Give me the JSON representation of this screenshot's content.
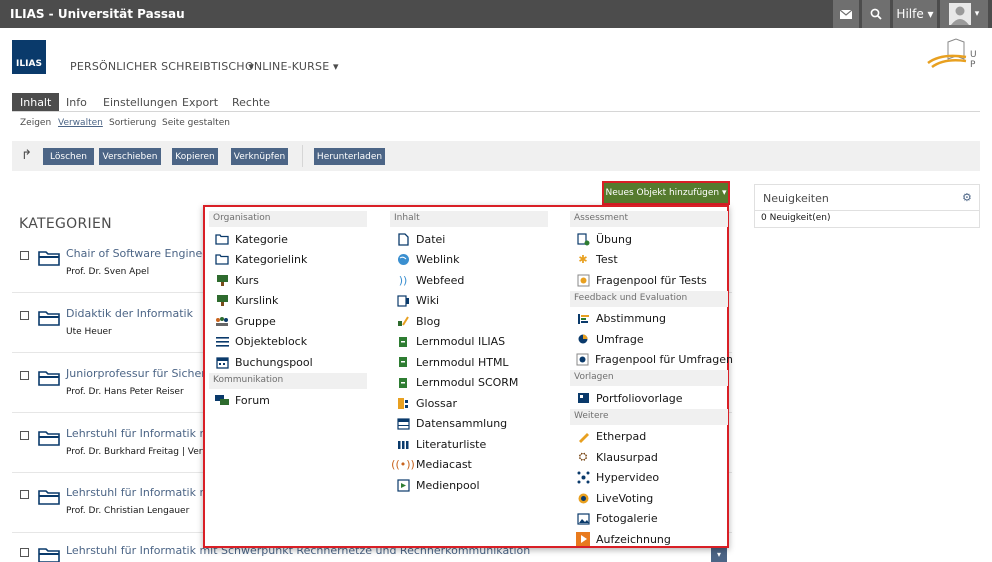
{
  "topbar": {
    "title": "ILIAS - Universität Passau",
    "help_label": "Hilfe ▾",
    "mail_icon": "mail-icon",
    "search_icon": "search-icon",
    "avatar_icon": "avatar-icon"
  },
  "header": {
    "logo_text": "ILIAS",
    "nav": [
      "PERSÖNLICHER SCHREIBTISCH ▾",
      "ONLINE-KURSE ▾"
    ],
    "university_logo": "university-passau-logo"
  },
  "tabs": [
    "Inhalt",
    "Info",
    "Einstellungen",
    "Export",
    "Rechte"
  ],
  "subtabs": [
    "Zeigen",
    "Verwalten",
    "Sortierung",
    "Seite gestalten"
  ],
  "toolbar": {
    "buttons": [
      "Löschen",
      "Verschieben",
      "Kopieren",
      "Verknüpfen",
      "Herunterladen"
    ]
  },
  "add_button": "Neues Objekt hinzufügen ▾",
  "section_title": "KATEGORIEN",
  "categories": [
    {
      "title": "Chair of Software Engineering",
      "desc": "Prof. Dr. Sven Apel"
    },
    {
      "title": "Didaktik der Informatik",
      "desc": "Ute Heuer"
    },
    {
      "title": "Juniorprofessur für Sicherheit",
      "desc": "Prof. Dr. Hans Peter Reiser"
    },
    {
      "title": "Lehrstuhl für Informatik mit S",
      "desc": "Prof. Dr. Burkhard Freitag | Vert"
    },
    {
      "title": "Lehrstuhl für Informatik mit S",
      "desc": "Prof. Dr. Christian Lengauer"
    },
    {
      "title": "Lehrstuhl für Informatik mit Schwerpunkt Rechnernetze und Rechnerkommunikation",
      "desc": ""
    }
  ],
  "news": {
    "title": "Neuigkeiten",
    "count": "0 Neuigkeit(en)"
  },
  "dropdown": {
    "col1": [
      {
        "group": "Organisation",
        "items": [
          {
            "label": "Kategorie",
            "icon": "folder-icon"
          },
          {
            "label": "Kategorielink",
            "icon": "folder-link-icon"
          },
          {
            "label": "Kurs",
            "icon": "course-icon"
          },
          {
            "label": "Kurslink",
            "icon": "course-link-icon"
          },
          {
            "label": "Gruppe",
            "icon": "group-icon"
          },
          {
            "label": "Objekteblock",
            "icon": "list-icon"
          },
          {
            "label": "Buchungspool",
            "icon": "calendar-icon"
          }
        ]
      },
      {
        "group": "Kommunikation",
        "items": [
          {
            "label": "Forum",
            "icon": "forum-icon"
          }
        ]
      }
    ],
    "col2": [
      {
        "group": "Inhalt",
        "items": [
          {
            "label": "Datei",
            "icon": "file-icon"
          },
          {
            "label": "Weblink",
            "icon": "globe-icon"
          },
          {
            "label": "Webfeed",
            "icon": "rss-icon"
          },
          {
            "label": "Wiki",
            "icon": "wiki-icon"
          },
          {
            "label": "Blog",
            "icon": "blog-icon"
          },
          {
            "label": "Lernmodul ILIAS",
            "icon": "module-icon"
          },
          {
            "label": "Lernmodul HTML",
            "icon": "module-html-icon"
          },
          {
            "label": "Lernmodul SCORM",
            "icon": "module-scorm-icon"
          },
          {
            "label": "Glossar",
            "icon": "glossary-icon"
          },
          {
            "label": "Datensammlung",
            "icon": "table-icon"
          },
          {
            "label": "Literaturliste",
            "icon": "books-icon"
          },
          {
            "label": "Mediacast",
            "icon": "broadcast-icon"
          },
          {
            "label": "Medienpool",
            "icon": "media-icon"
          }
        ]
      }
    ],
    "col3": [
      {
        "group": "Assessment",
        "items": [
          {
            "label": "Übung",
            "icon": "exercise-icon"
          },
          {
            "label": "Test",
            "icon": "puzzle-icon"
          },
          {
            "label": "Fragenpool für Tests",
            "icon": "question-pool-icon"
          }
        ]
      },
      {
        "group": "Feedback und Evaluation",
        "items": [
          {
            "label": "Abstimmung",
            "icon": "poll-icon"
          },
          {
            "label": "Umfrage",
            "icon": "survey-icon"
          },
          {
            "label": "Fragenpool für Umfragen",
            "icon": "survey-pool-icon"
          }
        ]
      },
      {
        "group": "Vorlagen",
        "items": [
          {
            "label": "Portfoliovorlage",
            "icon": "portfolio-icon"
          }
        ]
      },
      {
        "group": "Weitere",
        "items": [
          {
            "label": "Etherpad",
            "icon": "pencil-icon"
          },
          {
            "label": "Klausurpad",
            "icon": "exam-icon"
          },
          {
            "label": "Hypervideo",
            "icon": "hypervideo-icon"
          },
          {
            "label": "LiveVoting",
            "icon": "voting-icon"
          },
          {
            "label": "Fotogalerie",
            "icon": "photo-icon"
          },
          {
            "label": "Aufzeichnung",
            "icon": "recording-icon"
          }
        ]
      }
    ]
  },
  "colors": {
    "topbar": "#4c4c4c",
    "link": "#4c6586",
    "add_button": "#557b2e",
    "highlight": "#d91f26"
  }
}
